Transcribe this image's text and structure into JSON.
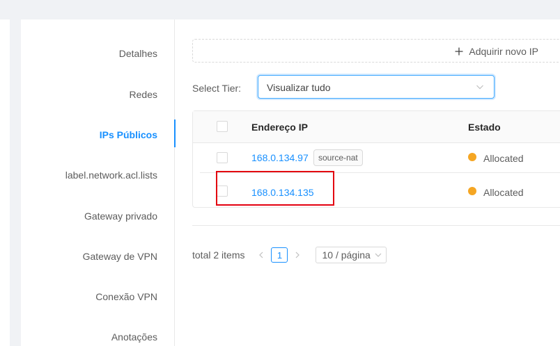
{
  "nav": {
    "items": [
      {
        "label": "Detalhes"
      },
      {
        "label": "Redes"
      },
      {
        "label": "IPs Públicos"
      },
      {
        "label": "label.network.acl.lists"
      },
      {
        "label": "Gateway privado"
      },
      {
        "label": "Gateway de VPN"
      },
      {
        "label": "Conexão VPN"
      },
      {
        "label": "Anotações"
      }
    ]
  },
  "toolbar": {
    "acquire_label": "Adquirir novo IP"
  },
  "tier": {
    "label": "Select Tier:",
    "value": "Visualizar tudo"
  },
  "table": {
    "headers": {
      "ip": "Endereço IP",
      "state": "Estado"
    },
    "rows": [
      {
        "ip": "168.0.134.97",
        "tag": "source-nat",
        "state": "Allocated"
      },
      {
        "ip": "168.0.134.135",
        "tag": "",
        "state": "Allocated"
      }
    ]
  },
  "pagination": {
    "total": "total 2 items",
    "current_page": "1",
    "page_size": "10 / página"
  },
  "colors": {
    "accent": "#1890ff",
    "status_allocated": "#f5a623",
    "highlight": "#e3000f"
  }
}
